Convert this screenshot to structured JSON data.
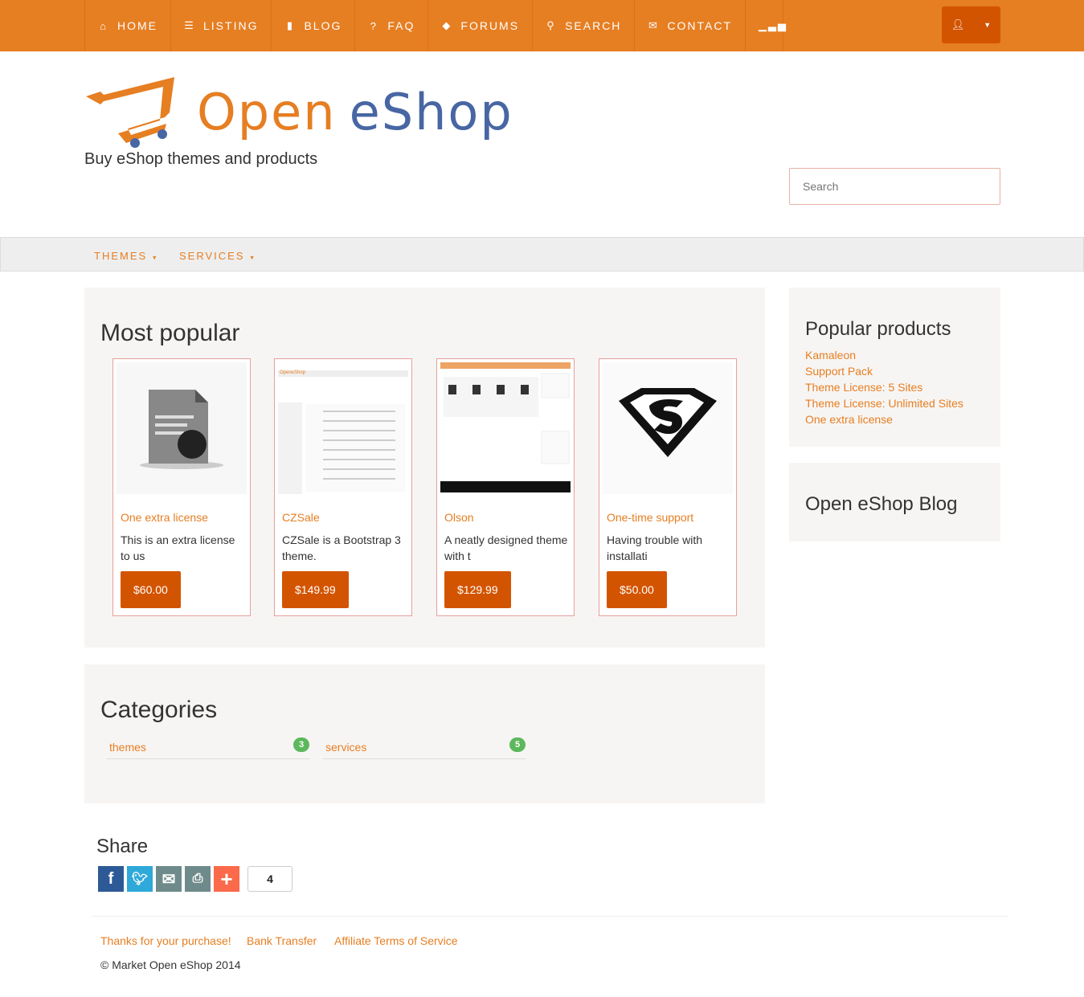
{
  "nav": {
    "items": [
      {
        "label": "HOME",
        "icon": "home-icon"
      },
      {
        "label": "LISTING",
        "icon": "list-icon"
      },
      {
        "label": "BLOG",
        "icon": "file-icon"
      },
      {
        "label": "FAQ",
        "icon": "question-icon"
      },
      {
        "label": "FORUMS",
        "icon": "tag-icon"
      },
      {
        "label": "SEARCH",
        "icon": "search-icon"
      },
      {
        "label": "CONTACT",
        "icon": "envelope-icon"
      }
    ],
    "stats_icon": "signal-icon",
    "user_icon": "user-icon"
  },
  "header": {
    "logo_word1": "Open",
    "logo_word2": "eShop",
    "tagline": "Buy eShop themes and products",
    "search_placeholder": "Search"
  },
  "subnav": {
    "items": [
      "THEMES",
      "SERVICES"
    ]
  },
  "popular": {
    "title": "Most popular",
    "products": [
      {
        "title": "One extra license",
        "desc": "This is an extra license to us",
        "price": "$60.00"
      },
      {
        "title": "CZSale",
        "desc": "CZSale is a Bootstrap 3 theme.",
        "price": "$149.99"
      },
      {
        "title": "Olson",
        "desc": "A neatly designed theme with t",
        "price": "$129.99"
      },
      {
        "title": "One-time support",
        "desc": "Having trouble with installati",
        "price": "$50.00"
      }
    ]
  },
  "categories": {
    "title": "Categories",
    "items": [
      {
        "name": "themes",
        "count": "3"
      },
      {
        "name": "services",
        "count": "5"
      }
    ]
  },
  "sidebar": {
    "popular_title": "Popular products",
    "popular_items": [
      "Kamaleon",
      "Support Pack",
      "Theme License: 5 Sites",
      "Theme License: Unlimited Sites",
      "One extra license"
    ],
    "blog_title": "Open eShop Blog"
  },
  "share": {
    "title": "Share",
    "count": "4"
  },
  "footer": {
    "links": [
      "Thanks for your purchase!",
      "Bank Transfer",
      "Affiliate Terms of Service"
    ],
    "copyright": "© Market Open eShop 2014"
  },
  "colors": {
    "primary": "#e67e22",
    "button": "#d35400",
    "logo_blue": "#4766a3",
    "badge": "#5cb85c"
  }
}
